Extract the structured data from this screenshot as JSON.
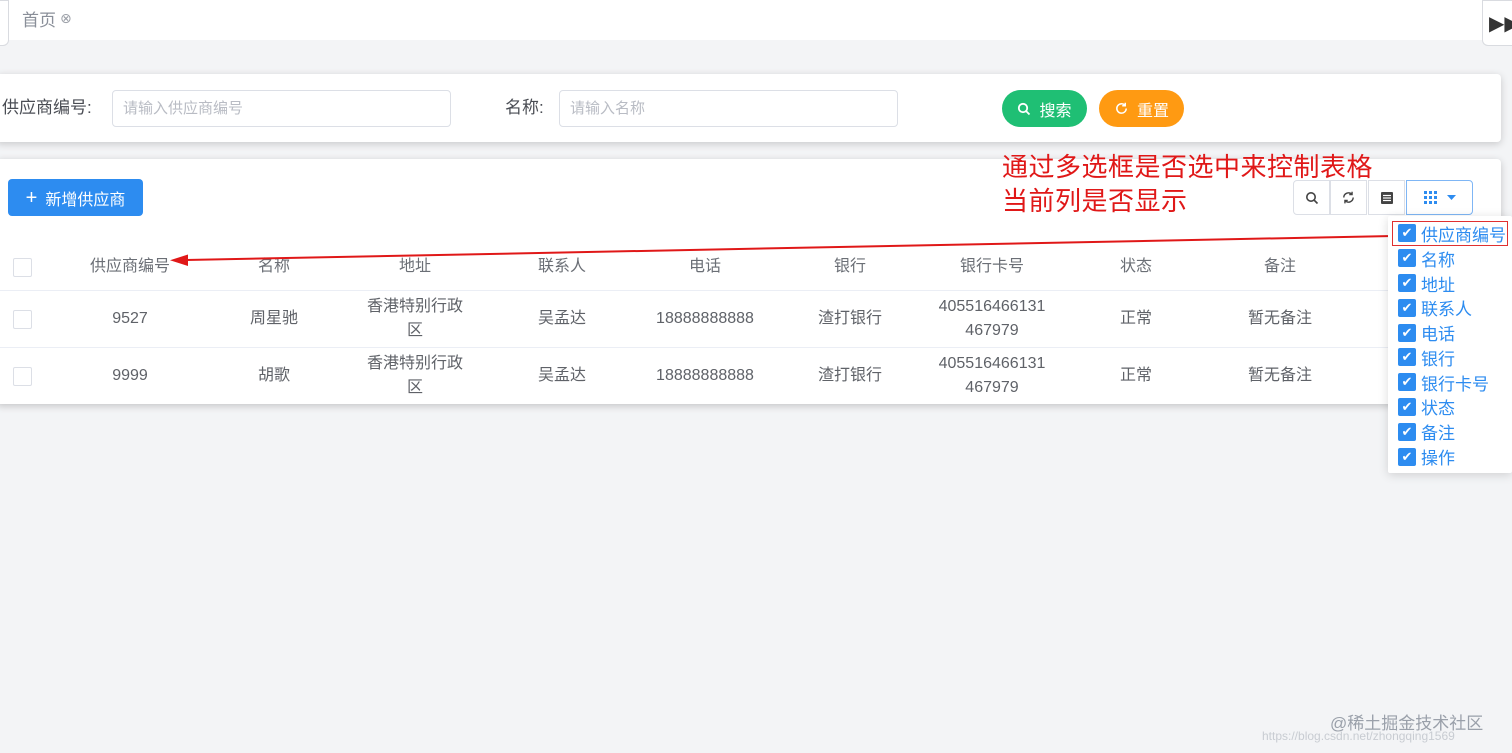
{
  "tabs": {
    "home_label": "首页",
    "close_glyph": "⊗",
    "right_glyph": "▶▶"
  },
  "search": {
    "supplier_no_label": "供应商编号:",
    "supplier_no_placeholder": "请输入供应商编号",
    "name_label": "名称:",
    "name_placeholder": "请输入名称",
    "search_button": "搜索",
    "reset_button": "重置"
  },
  "toolbar": {
    "add_button": "新增供应商"
  },
  "table": {
    "headers": [
      "供应商编号",
      "名称",
      "地址",
      "联系人",
      "电话",
      "银行",
      "银行卡号",
      "状态",
      "备注"
    ],
    "rows": [
      [
        "9527",
        "周星驰",
        "香港特别行政区",
        "吴孟达",
        "18888888888",
        "渣打银行",
        "405516466131467979",
        "正常",
        "暂无备注"
      ],
      [
        "9999",
        "胡歌",
        "香港特别行政区",
        "吴孟达",
        "18888888888",
        "渣打银行",
        "405516466131467979",
        "正常",
        "暂无备注"
      ]
    ]
  },
  "annotation": {
    "line1": "通过多选框是否选中来控制表格",
    "line2": "当前列是否显示",
    "color": "#e01818"
  },
  "column_menu": {
    "items": [
      "供应商编号",
      "名称",
      "地址",
      "联系人",
      "电话",
      "银行",
      "银行卡号",
      "状态",
      "备注",
      "操作"
    ]
  },
  "watermark": {
    "text": "@稀土掘金技术社区",
    "url": "https://blog.csdn.net/zhongqing1569"
  },
  "colors": {
    "primary": "#2d8cf0",
    "success": "#1fbf74",
    "warning": "#ff9a12"
  }
}
